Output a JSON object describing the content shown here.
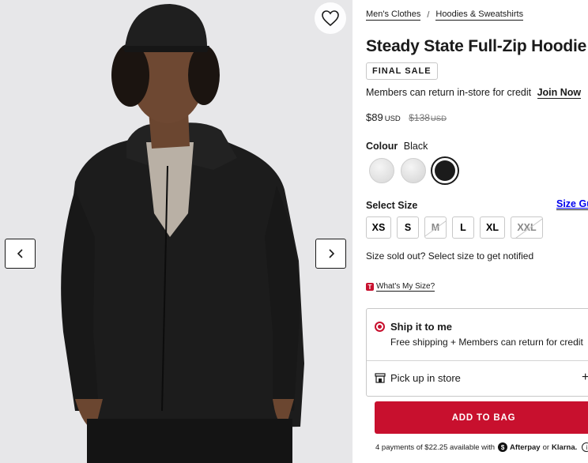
{
  "gallery": {
    "wishlist_icon": "heart-icon",
    "prev_icon": "chevron-left-icon",
    "next_icon": "chevron-right-icon"
  },
  "breadcrumb": {
    "items": [
      "Men's Clothes",
      "Hoodies & Sweatshirts"
    ],
    "separator": "/"
  },
  "product": {
    "title": "Steady State Full-Zip Hoodie",
    "badge": "FINAL SALE",
    "members_text": "Members can return in-store for credit",
    "join_link": "Join Now",
    "price_now": "$89",
    "price_now_currency": "USD",
    "price_was": "$138",
    "price_was_currency": "USD"
  },
  "colour": {
    "label": "Colour",
    "selected": "Black",
    "swatches": [
      "light-heather-grey",
      "light-grey",
      "black"
    ]
  },
  "size": {
    "label": "Select Size",
    "guide": "Size Gu",
    "options": [
      {
        "label": "XS",
        "sold_out": false
      },
      {
        "label": "S",
        "sold_out": false
      },
      {
        "label": "M",
        "sold_out": true
      },
      {
        "label": "L",
        "sold_out": false
      },
      {
        "label": "XL",
        "sold_out": false
      },
      {
        "label": "XXL",
        "sold_out": true
      }
    ],
    "sold_out_notice": "Size sold out? Select size to get notified",
    "whats_my_size_icon": "T",
    "whats_my_size": "What's My Size?"
  },
  "fulfillment": {
    "ship_title": "Ship it to me",
    "ship_sub": "Free shipping + Members can return for credit",
    "pickup_label": "Pick up in store",
    "pickup_expand": "+"
  },
  "cart": {
    "add_label": "ADD TO BAG"
  },
  "payments": {
    "text": "4 payments of $22.25 available with",
    "afterpay": "Afterpay",
    "or": "or",
    "klarna": "Klarna."
  },
  "colors": {
    "accent": "#c8102e",
    "text": "#1a1a1a",
    "gallery_bg": "#e7e7e9"
  }
}
